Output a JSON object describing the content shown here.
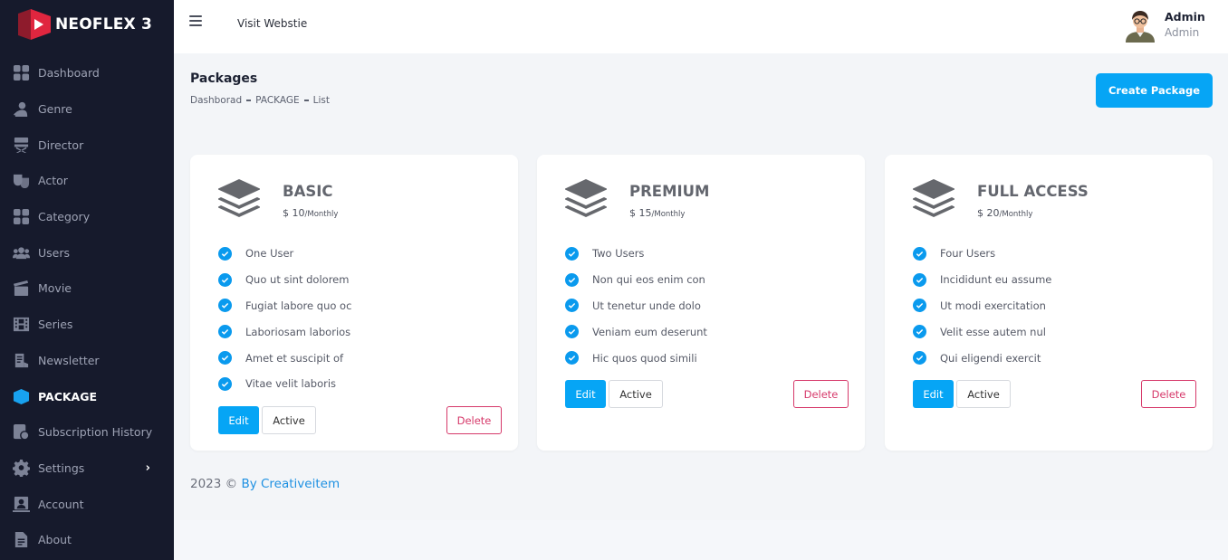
{
  "brand": {
    "name": "NEOFLEX 3"
  },
  "sidebar": {
    "items": [
      {
        "label": "Dashboard",
        "icon": "dashboard-icon"
      },
      {
        "label": "Genre",
        "icon": "genre-icon"
      },
      {
        "label": "Director",
        "icon": "director-chair-icon"
      },
      {
        "label": "Actor",
        "icon": "theater-masks-icon"
      },
      {
        "label": "Category",
        "icon": "category-grid-icon"
      },
      {
        "label": "Users",
        "icon": "users-icon"
      },
      {
        "label": "Movie",
        "icon": "clapperboard-icon"
      },
      {
        "label": "Series",
        "icon": "film-icon"
      },
      {
        "label": "Newsletter",
        "icon": "newsletter-icon"
      },
      {
        "label": "PACKAGE",
        "icon": "package-icon",
        "active": true
      },
      {
        "label": "Subscription History",
        "icon": "subscription-history-icon"
      },
      {
        "label": "Settings",
        "icon": "gear-icon",
        "chevron": "›"
      },
      {
        "label": "Account",
        "icon": "account-icon"
      },
      {
        "label": "About",
        "icon": "document-icon"
      }
    ]
  },
  "header": {
    "visit_label": "Visit Webstie",
    "user_name": "Admin",
    "user_role": "Admin"
  },
  "page": {
    "title": "Packages",
    "breadcrumb": [
      "Dashborad",
      "PACKAGE",
      "List"
    ],
    "create_label": "Create Package"
  },
  "packages": [
    {
      "name": "BASIC",
      "price": "$ 10",
      "period": "/Monthly",
      "features": [
        "One User",
        "Quo ut sint dolorem",
        "Fugiat labore quo oc",
        "Laboriosam laborios",
        "Amet et suscipit of",
        "Vitae velit laboris"
      ],
      "edit_label": "Edit",
      "status_label": "Active",
      "delete_label": "Delete"
    },
    {
      "name": "PREMIUM",
      "price": "$ 15",
      "period": "/Monthly",
      "features": [
        "Two Users",
        "Non qui eos enim con",
        "Ut tenetur unde dolo",
        "Veniam eum deserunt",
        "Hic quos quod simili"
      ],
      "edit_label": "Edit",
      "status_label": "Active",
      "delete_label": "Delete"
    },
    {
      "name": "FULL ACCESS",
      "price": "$ 20",
      "period": "/Monthly",
      "features": [
        "Four Users",
        "Incididunt eu assume",
        "Ut modi exercitation",
        "Velit esse autem nul",
        "Qui eligendi exercit"
      ],
      "edit_label": "Edit",
      "status_label": "Active",
      "delete_label": "Delete"
    }
  ],
  "footer": {
    "copyright": "2023 ©",
    "link_label": "By Creativeitem"
  },
  "colors": {
    "sidebar_bg": "#161a2c",
    "accent": "#06a5f5",
    "delete": "#d6396a",
    "brand_red": "#e0263f"
  }
}
